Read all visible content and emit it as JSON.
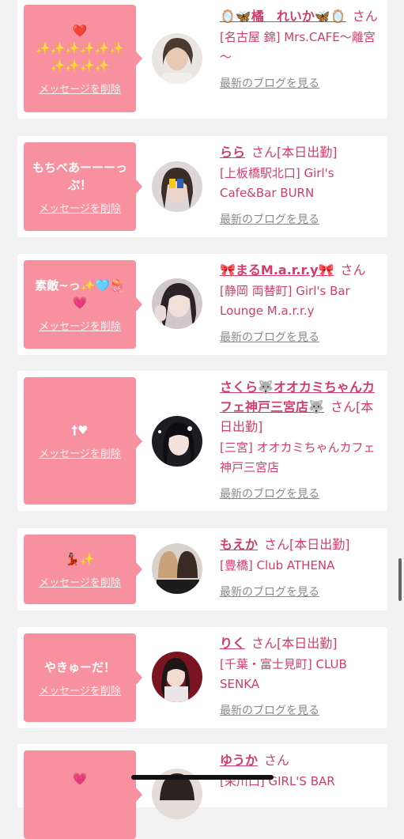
{
  "colors": {
    "bubble": "#f7919f",
    "accent": "#d13c6d",
    "muted": "#8a8a8a"
  },
  "delete_label": "メッセージを削除",
  "blog_label": "最新のブログを見る",
  "san_label": "さん",
  "cards": [
    {
      "message": "❤️\n✨✨✨✨✨✨\n✨✨✨✨",
      "name": "🪞🦋橘　れいか🦋🪞",
      "status": "",
      "shop": "[名古屋 錦] Mrs.CAFE～離宮～"
    },
    {
      "message": "もちべあーーーっぷ！",
      "name": "らら",
      "status": "[本日出勤]",
      "shop": "[上板橋駅北口] Girl's Cafe&Bar BURN"
    },
    {
      "message": "素敵~っ✨🩵🪼💗",
      "name": "🎀まるM.a.r.r.y🎀",
      "status": "",
      "shop": "[静岡 両替町] Girl's Bar Lounge M.a.r.r.y"
    },
    {
      "message": "†♥",
      "name": "さくら🐺オオカミちゃんカフェ神戸三宮店🐺",
      "status": "[本日出勤]",
      "shop": "[三宮] オオカミちゃんカフェ神戸三宮店"
    },
    {
      "message": "💃🏽✨",
      "name": "もえか",
      "status": "[本日出勤]",
      "shop": "[豊橋] Club ATHENA"
    },
    {
      "message": "やきゅーだ！",
      "name": "りく",
      "status": "[本日出勤]",
      "shop": "[千葉・富士見町] CLUB SENKA"
    },
    {
      "message": "💗",
      "name": "ゆうか",
      "status": "",
      "shop": "[栄川口] GIRL'S BAR"
    }
  ]
}
